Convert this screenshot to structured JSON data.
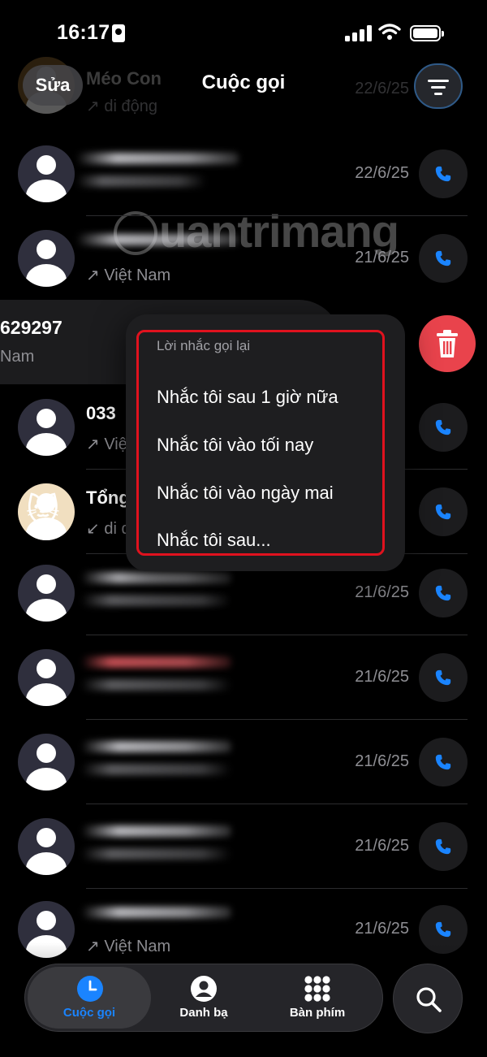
{
  "status_bar": {
    "time": "16:17"
  },
  "header": {
    "edit_label": "Sửa",
    "title": "Cuộc gọi"
  },
  "ghost_row": {
    "name": "Méo Con",
    "sub": "di động",
    "date": "22/6/25"
  },
  "rows": [
    {
      "date": "22/6/25"
    },
    {
      "sub": "Việt Nam",
      "date": "21/6/25"
    },
    {
      "name": "033",
      "sub": "Việ"
    },
    {
      "name": "Tổng",
      "sub": "di d"
    },
    {
      "date": "21/6/25"
    },
    {
      "date": "21/6/25"
    },
    {
      "date": "21/6/25"
    },
    {
      "date": "21/6/25"
    },
    {
      "sub": "Việt Nam",
      "date": "21/6/25"
    }
  ],
  "swiped_row": {
    "number": "629297",
    "sub": "Nam"
  },
  "menu": {
    "header": "Lời nhắc gọi lại",
    "items": [
      "Nhắc tôi sau 1 giờ nữa",
      "Nhắc tôi vào tối nay",
      "Nhắc tôi vào ngày mai",
      "Nhắc tôi sau..."
    ]
  },
  "watermark": "uantrimang",
  "tabs": [
    {
      "label": "Cuộc gọi",
      "icon": "clock-icon",
      "active": true
    },
    {
      "label": "Danh bạ",
      "icon": "person-circle-icon"
    },
    {
      "label": "Bàn phím",
      "icon": "keypad-icon"
    }
  ],
  "colors": {
    "accent": "#1a84ff",
    "delete": "#e9434c",
    "highlight_outline": "#e0121e"
  }
}
